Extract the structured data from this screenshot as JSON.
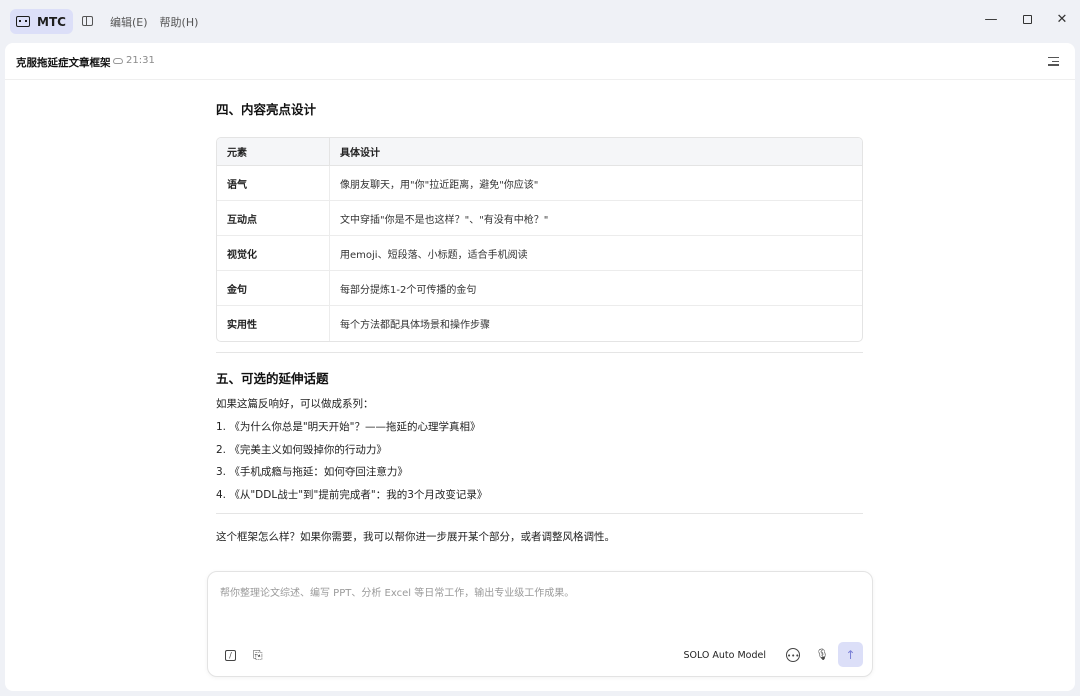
{
  "app": {
    "name": "MTC"
  },
  "menu": [
    {
      "label": "编辑(E)"
    },
    {
      "label": "帮助(H)"
    }
  ],
  "window_controls": {
    "minimize": "—",
    "close": "✕"
  },
  "document": {
    "title": "克服拖延症文章框架",
    "time": "21:31"
  },
  "section4": {
    "heading": "四、内容亮点设计",
    "table": {
      "headers": [
        "元素",
        "具体设计"
      ],
      "rows": [
        [
          "语气",
          "像朋友聊天，用\"你\"拉近距离，避免\"你应该\""
        ],
        [
          "互动点",
          "文中穿插\"你是不是也这样？\"、\"有没有中枪？\""
        ],
        [
          "视觉化",
          "用emoji、短段落、小标题，适合手机阅读"
        ],
        [
          "金句",
          "每部分提炼1-2个可传播的金句"
        ],
        [
          "实用性",
          "每个方法都配具体场景和操作步骤"
        ]
      ]
    }
  },
  "section5": {
    "heading": "五、可选的延伸话题",
    "intro": "如果这篇反响好，可以做成系列：",
    "items": [
      "1. 《为什么你总是\"明天开始\"？——拖延的心理学真相》",
      "2. 《完美主义如何毁掉你的行动力》",
      "3. 《手机成瘾与拖延：如何夺回注意力》",
      "4. 《从\"DDL战士\"到\"提前完成者\"：我的3个月改变记录》"
    ]
  },
  "closing": "这个框架怎么样？如果你需要，我可以帮你进一步展开某个部分，或者调整风格调性。",
  "composer": {
    "placeholder": "帮你整理论文综述、编写 PPT、分析 Excel 等日常工作，输出专业级工作成果。",
    "model": "SOLO Auto Model"
  },
  "icons": {
    "app_logo": "robot-icon",
    "sidebar": "sidebar-toggle-icon",
    "cloud": "cloud-icon",
    "outline": "outline-icon",
    "slash": "slash-command-icon",
    "attach": "paperclip-icon",
    "chat": "chat-mode-icon",
    "mic": "microphone-icon",
    "send": "arrow-up-icon"
  },
  "colors": {
    "accent_bg": "#dcdff8",
    "send_arrow": "#7a7fd6",
    "window_bg": "#eff1f6"
  }
}
